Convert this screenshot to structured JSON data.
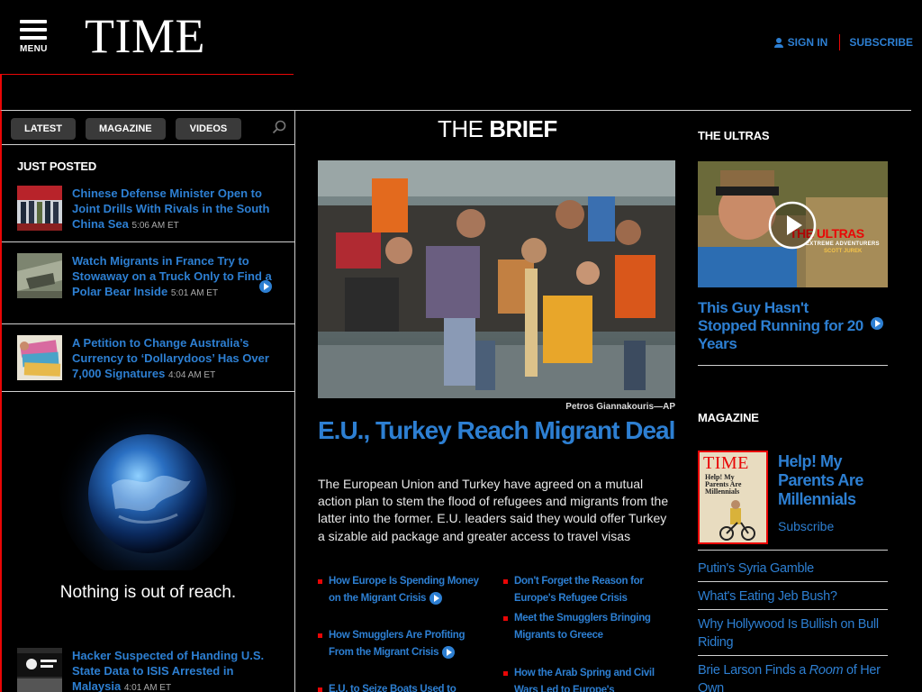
{
  "header": {
    "menu_label": "MENU",
    "logo": "TIME",
    "sign_in": "SIGN IN",
    "subscribe": "SUBSCRIBE"
  },
  "tabs": [
    {
      "label": "LATEST"
    },
    {
      "label": "MAGAZINE"
    },
    {
      "label": "VIDEOS"
    }
  ],
  "just_posted": {
    "title": "JUST POSTED",
    "items": [
      {
        "title": "Chinese Defense Minister Open to Joint Drills With Rivals in the South China Sea",
        "time": "5:06 AM ET"
      },
      {
        "title": "Watch Migrants in France Try to Stowaway on a Truck Only to Find a Polar Bear Inside",
        "time": "5:01 AM ET"
      },
      {
        "title": "A Petition to Change Australia’s Currency to ‘Dollarydoos’ Has Over 7,000 Signatures",
        "time": "4:04 AM ET"
      },
      {
        "title": "Hacker Suspected of Handing U.S. State Data to ISIS Arrested in Malaysia",
        "time": "4:01 AM ET"
      }
    ]
  },
  "ad": {
    "text": "Nothing is out of reach."
  },
  "brief": {
    "prefix": "THE ",
    "bold": "BRIEF",
    "photo_credit": "Petros Giannakouris—AP",
    "headline": "E.U., Turkey Reach Migrant Deal",
    "summary": "The European Union and Turkey have agreed on a mutual action plan to stem the flood of refugees and migrants from the latter into the former. E.U. leaders said they would offer Turkey a sizable aid package and greater access to travel visas",
    "related": [
      {
        "text": "How Europe Is Spending Money on the Migrant Crisis"
      },
      {
        "text": "Don't Forget the Reason for Europe's Refugee Crisis"
      },
      {
        "text": "How Smugglers Are Profiting From the Migrant Crisis"
      },
      {
        "text": "Meet the Smugglers Bringing Migrants to Greece"
      },
      {
        "text": "E.U. to Seize Boats Used to"
      },
      {
        "text": "How the Arab Spring and Civil Wars Led to Europe's"
      }
    ]
  },
  "ultras": {
    "title": "THE ULTRAS",
    "image_title": "THE ULTRAS",
    "image_subtitle": "EXTREME ADVENTURERS",
    "image_name": "SCOTT JUREK",
    "link": "This Guy Hasn't Stopped Running for 20 Years"
  },
  "magazine": {
    "title": "MAGAZINE",
    "cover_name": "TIME",
    "cover_text": "Help! My Parents Are Millennials",
    "headline": "Help! My Parents Are Millennials",
    "subscribe": "Subscribe",
    "links": [
      {
        "text": "Putin's Syria Gamble"
      },
      {
        "text": "What's Eating Jeb Bush?"
      },
      {
        "text": "Why Hollywood Is Bullish on Bull Riding"
      }
    ],
    "last_link_pre": "Brie Larson Finds a ",
    "last_link_em": "Room",
    "last_link_post": " of Her Own"
  },
  "colors": {
    "accent_blue": "#2d7fd2",
    "accent_red": "#e90606",
    "background": "#000000"
  }
}
